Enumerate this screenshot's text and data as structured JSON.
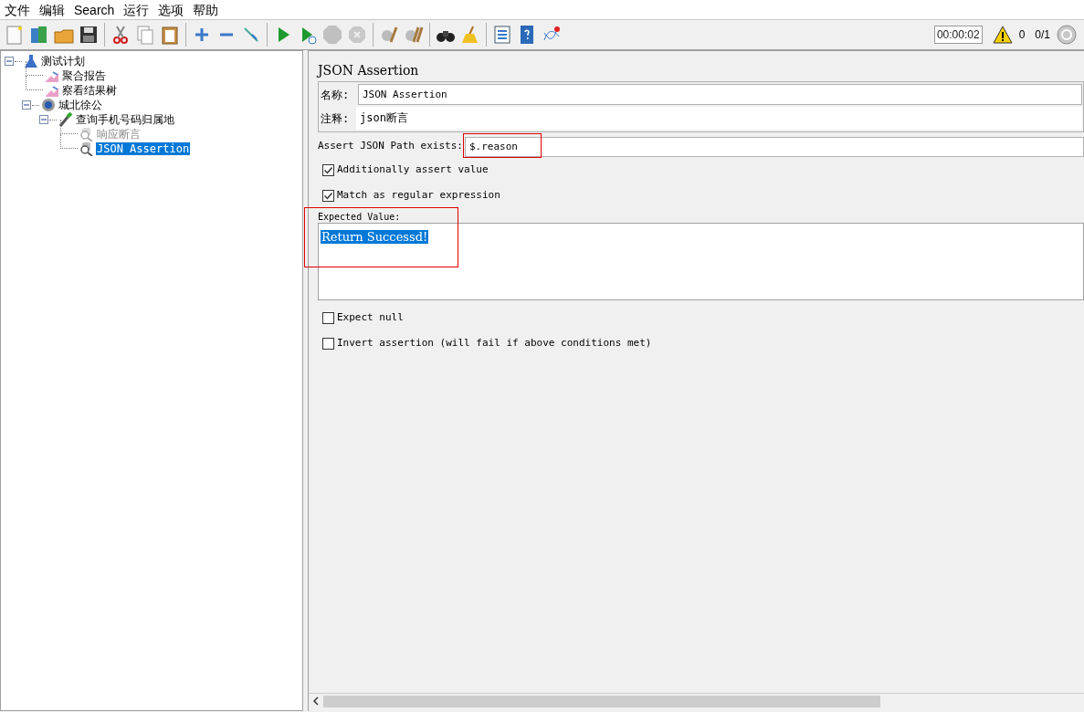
{
  "menu": [
    "文件",
    "编辑",
    "Search",
    "运行",
    "选项",
    "帮助"
  ],
  "status": {
    "timer": "00:00:02",
    "warnings": "0",
    "threads": "0/1"
  },
  "tree": [
    {
      "label": "测试计划",
      "kind": "plan",
      "expanded": true,
      "selected": false,
      "disabled": false,
      "children": [
        {
          "label": "聚合报告",
          "kind": "listener",
          "selected": false,
          "disabled": false
        },
        {
          "label": "察看结果树",
          "kind": "listener",
          "selected": false,
          "disabled": false
        },
        {
          "label": "城北徐公",
          "kind": "threadgroup",
          "expanded": true,
          "selected": false,
          "disabled": false,
          "children": [
            {
              "label": "查询手机号码归属地",
              "kind": "sampler",
              "expanded": true,
              "selected": false,
              "disabled": false,
              "children": [
                {
                  "label": "响应断言",
                  "kind": "assertion",
                  "selected": false,
                  "disabled": true
                },
                {
                  "label": "JSON Assertion",
                  "kind": "assertion",
                  "selected": true,
                  "disabled": false
                }
              ]
            }
          ]
        }
      ]
    }
  ],
  "panel": {
    "title": "JSON Assertion",
    "name_label": "名称:",
    "name_value": "JSON Assertion",
    "comment_label": "注释:",
    "comment_value": "json断言",
    "path_label": "Assert JSON Path exists:",
    "path_value": "$.reason",
    "options_top": [
      {
        "label": "Additionally assert value",
        "checked": true
      },
      {
        "label": "Match as regular expression",
        "checked": true
      }
    ],
    "expected_label": "Expected Value:",
    "expected_value": "Return Successd!",
    "options_bottom": [
      {
        "label": "Expect null",
        "checked": false
      },
      {
        "label": "Invert assertion (will fail if above conditions met)",
        "checked": false
      }
    ]
  }
}
